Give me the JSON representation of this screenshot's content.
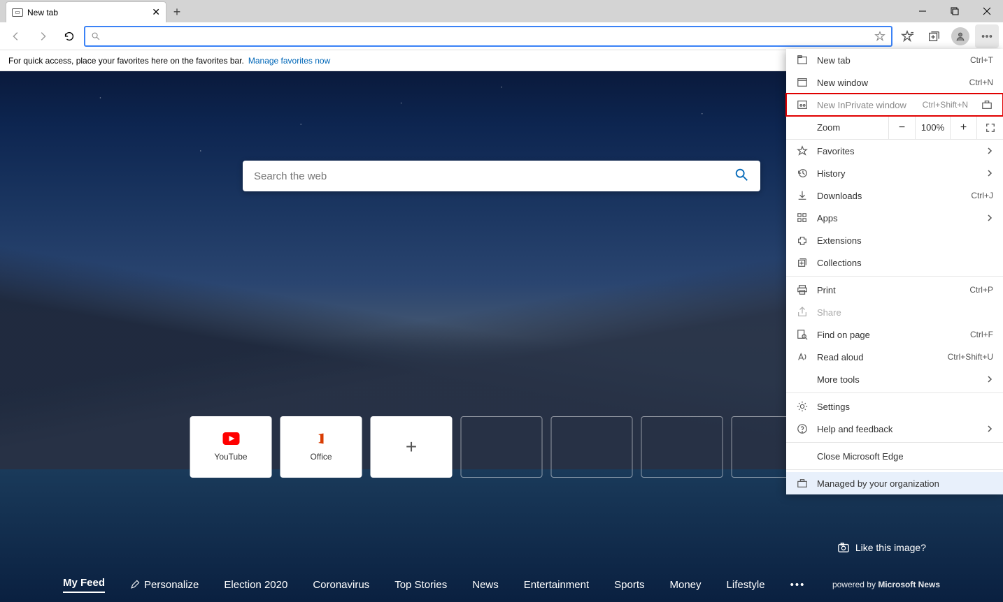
{
  "tab": {
    "title": "New tab"
  },
  "favorites_bar": {
    "hint": "For quick access, place your favorites here on the favorites bar.",
    "link": "Manage favorites now"
  },
  "search": {
    "placeholder": "Search the web"
  },
  "tiles": [
    {
      "label": "YouTube"
    },
    {
      "label": "Office"
    }
  ],
  "like": "Like this image?",
  "feed": {
    "items": [
      "My Feed",
      "Personalize",
      "Election 2020",
      "Coronavirus",
      "Top Stories",
      "News",
      "Entertainment",
      "Sports",
      "Money",
      "Lifestyle"
    ],
    "powered_pre": "powered by ",
    "powered_brand": "Microsoft News"
  },
  "menu": {
    "new_tab": {
      "label": "New tab",
      "shortcut": "Ctrl+T"
    },
    "new_window": {
      "label": "New window",
      "shortcut": "Ctrl+N"
    },
    "new_inprivate": {
      "label": "New InPrivate window",
      "shortcut": "Ctrl+Shift+N"
    },
    "zoom": {
      "label": "Zoom",
      "value": "100%"
    },
    "favorites": {
      "label": "Favorites"
    },
    "history": {
      "label": "History"
    },
    "downloads": {
      "label": "Downloads",
      "shortcut": "Ctrl+J"
    },
    "apps": {
      "label": "Apps"
    },
    "extensions": {
      "label": "Extensions"
    },
    "collections": {
      "label": "Collections"
    },
    "print": {
      "label": "Print",
      "shortcut": "Ctrl+P"
    },
    "share": {
      "label": "Share"
    },
    "find": {
      "label": "Find on page",
      "shortcut": "Ctrl+F"
    },
    "read_aloud": {
      "label": "Read aloud",
      "shortcut": "Ctrl+Shift+U"
    },
    "more_tools": {
      "label": "More tools"
    },
    "settings": {
      "label": "Settings"
    },
    "help": {
      "label": "Help and feedback"
    },
    "close": {
      "label": "Close Microsoft Edge"
    },
    "managed": {
      "label": "Managed by your organization"
    }
  }
}
